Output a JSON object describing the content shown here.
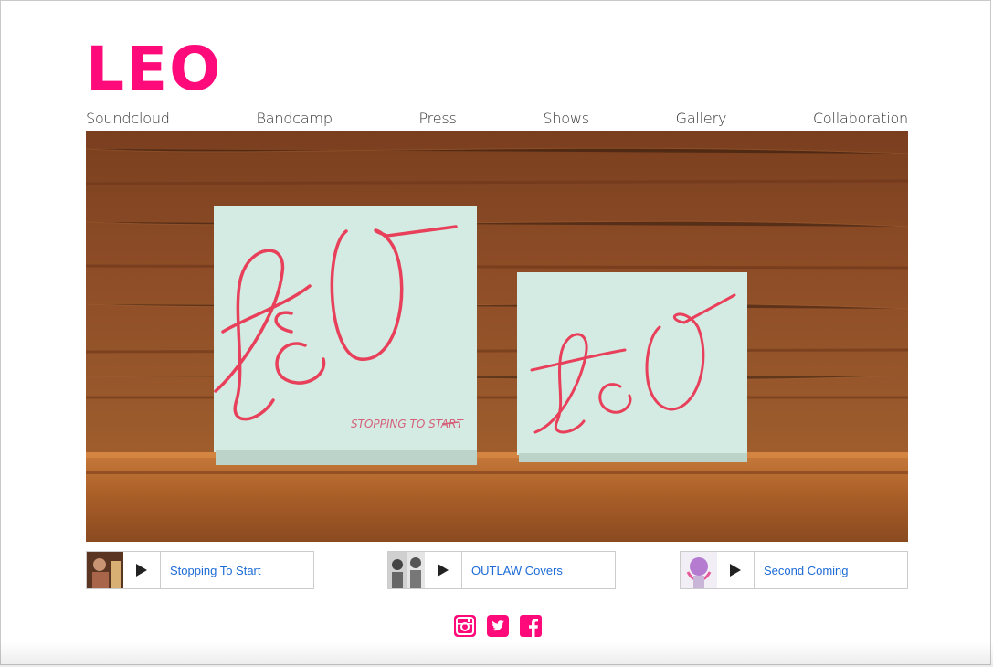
{
  "site": {
    "logo": "LEO",
    "accent_color": "#ff0a7a"
  },
  "nav": {
    "items": [
      {
        "label": "Soundcloud"
      },
      {
        "label": "Bandcamp"
      },
      {
        "label": "Press"
      },
      {
        "label": "Shows"
      },
      {
        "label": "Gallery"
      },
      {
        "label": "Collaboration"
      }
    ]
  },
  "hero": {
    "cover_large_text": "LEO",
    "cover_caption": "STOPPING TO START",
    "cover_small_text": "LEO"
  },
  "players": [
    {
      "title": "Stopping To Start",
      "icon": "play-icon"
    },
    {
      "title": "OUTLAW Covers",
      "icon": "play-icon"
    },
    {
      "title": "Second Coming",
      "icon": "play-icon"
    }
  ],
  "social": [
    {
      "name": "instagram-icon"
    },
    {
      "name": "twitter-icon"
    },
    {
      "name": "facebook-icon"
    }
  ]
}
